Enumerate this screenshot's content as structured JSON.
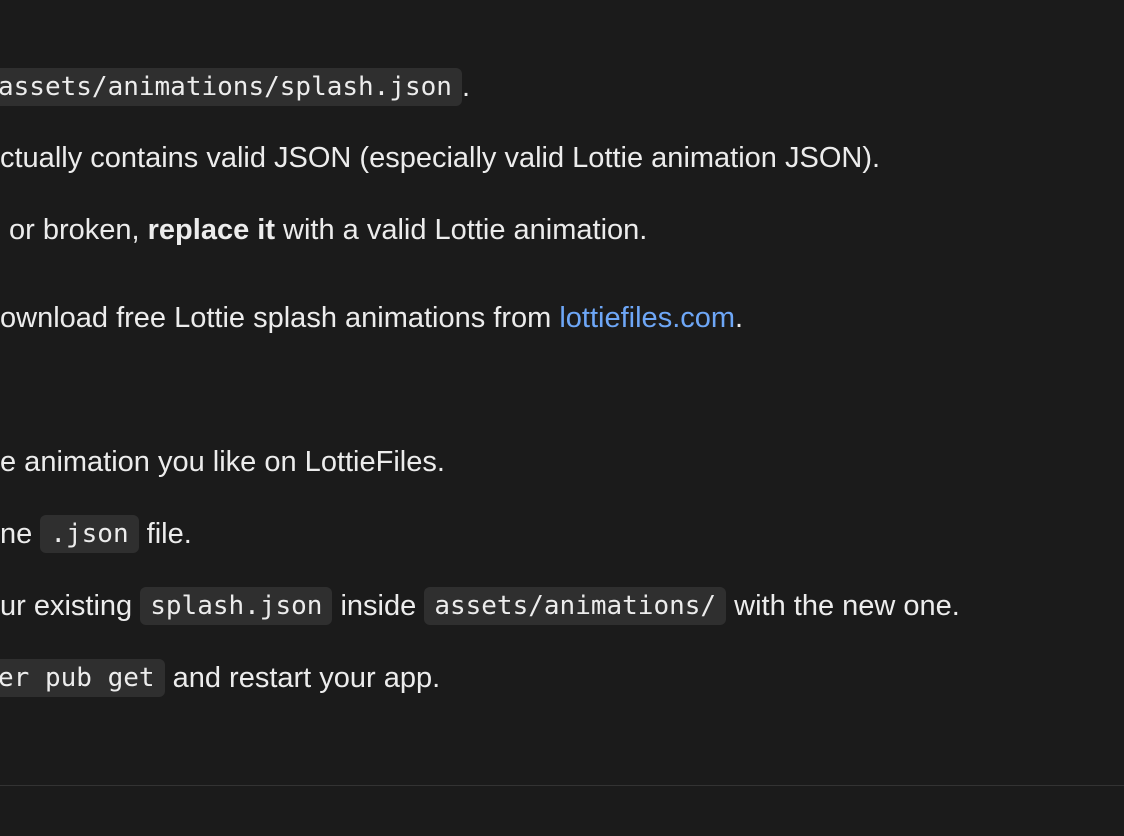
{
  "content": {
    "path_line": {
      "code": "assets/animations/splash.json",
      "after": "."
    },
    "check_line": {
      "text": "ctually contains valid JSON (especially valid Lottie animation JSON)."
    },
    "replace_line": {
      "before": "or broken, ",
      "bold": "replace it",
      "after": " with a valid Lottie animation."
    },
    "download_line": {
      "before": "ownload free Lottie splash animations from ",
      "link": "lottiefiles.com",
      "after": "."
    },
    "steps": {
      "step1": {
        "text": "e animation you like on LottieFiles."
      },
      "step2": {
        "before": "ne ",
        "code": ".json",
        "after": " file."
      },
      "step3": {
        "before": "ur existing ",
        "code1": "splash.json",
        "middle": " inside ",
        "code2": "assets/animations/",
        "after": " with the new one."
      },
      "step4": {
        "code": "er pub get",
        "after": " and restart your app."
      }
    }
  }
}
